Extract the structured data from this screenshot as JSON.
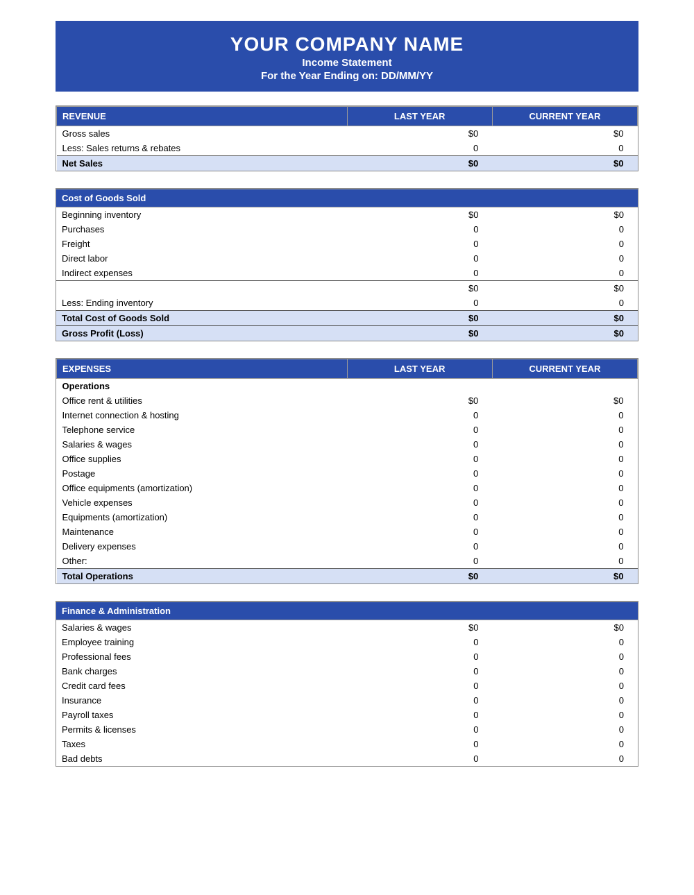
{
  "header": {
    "company": "YOUR COMPANY NAME",
    "subtitle": "Income Statement",
    "date_line": "For the Year Ending on: DD/MM/YY"
  },
  "revenue_section": {
    "title": "REVENUE",
    "col_last": "LAST YEAR",
    "col_current": "CURRENT YEAR",
    "rows": [
      {
        "label": "Gross sales",
        "last": "$0",
        "current": "$0"
      },
      {
        "label": "Less: Sales returns & rebates",
        "last": "0",
        "current": "0"
      }
    ],
    "net_sales_label": "Net Sales",
    "net_sales_last": "$0",
    "net_sales_current": "$0"
  },
  "cogs_section": {
    "title": "Cost of Goods Sold",
    "rows": [
      {
        "label": "Beginning inventory",
        "last": "$0",
        "current": "$0"
      },
      {
        "label": "Purchases",
        "last": "0",
        "current": "0"
      },
      {
        "label": "Freight",
        "last": "0",
        "current": "0"
      },
      {
        "label": "Direct labor",
        "last": "0",
        "current": "0"
      },
      {
        "label": "Indirect expenses",
        "last": "0",
        "current": "0"
      }
    ],
    "subtotal_last": "$0",
    "subtotal_current": "$0",
    "ending_inv_label": "Less: Ending inventory",
    "ending_inv_last": "0",
    "ending_inv_current": "0",
    "total_cogs_label": "Total Cost of Goods Sold",
    "total_cogs_last": "$0",
    "total_cogs_current": "$0",
    "gross_profit_label": "Gross Profit (Loss)",
    "gross_profit_last": "$0",
    "gross_profit_current": "$0"
  },
  "expenses_section": {
    "title": "EXPENSES",
    "col_last": "LAST YEAR",
    "col_current": "CURRENT YEAR",
    "operations_label": "Operations",
    "operations_rows": [
      {
        "label": "Office rent & utilities",
        "last": "$0",
        "current": "$0"
      },
      {
        "label": "Internet connection & hosting",
        "last": "0",
        "current": "0"
      },
      {
        "label": "Telephone service",
        "last": "0",
        "current": "0"
      },
      {
        "label": "Salaries & wages",
        "last": "0",
        "current": "0"
      },
      {
        "label": "Office supplies",
        "last": "0",
        "current": "0"
      },
      {
        "label": "Postage",
        "last": "0",
        "current": "0"
      },
      {
        "label": "Office equipments (amortization)",
        "last": "0",
        "current": "0"
      },
      {
        "label": "Vehicle expenses",
        "last": "0",
        "current": "0"
      },
      {
        "label": "Equipments (amortization)",
        "last": "0",
        "current": "0"
      },
      {
        "label": "Maintenance",
        "last": "0",
        "current": "0"
      },
      {
        "label": "Delivery expenses",
        "last": "0",
        "current": "0"
      },
      {
        "label": "Other:",
        "last": "0",
        "current": "0"
      }
    ],
    "total_operations_label": "Total Operations",
    "total_operations_last": "$0",
    "total_operations_current": "$0"
  },
  "finance_section": {
    "title": "Finance & Administration",
    "rows": [
      {
        "label": "Salaries & wages",
        "last": "$0",
        "current": "$0"
      },
      {
        "label": "Employee training",
        "last": "0",
        "current": "0"
      },
      {
        "label": "Professional fees",
        "last": "0",
        "current": "0"
      },
      {
        "label": "Bank charges",
        "last": "0",
        "current": "0"
      },
      {
        "label": "Credit card fees",
        "last": "0",
        "current": "0"
      },
      {
        "label": "Insurance",
        "last": "0",
        "current": "0"
      },
      {
        "label": "Payroll taxes",
        "last": "0",
        "current": "0"
      },
      {
        "label": "Permits & licenses",
        "last": "0",
        "current": "0"
      },
      {
        "label": "Taxes",
        "last": "0",
        "current": "0"
      },
      {
        "label": "Bad debts",
        "last": "0",
        "current": "0"
      }
    ]
  }
}
